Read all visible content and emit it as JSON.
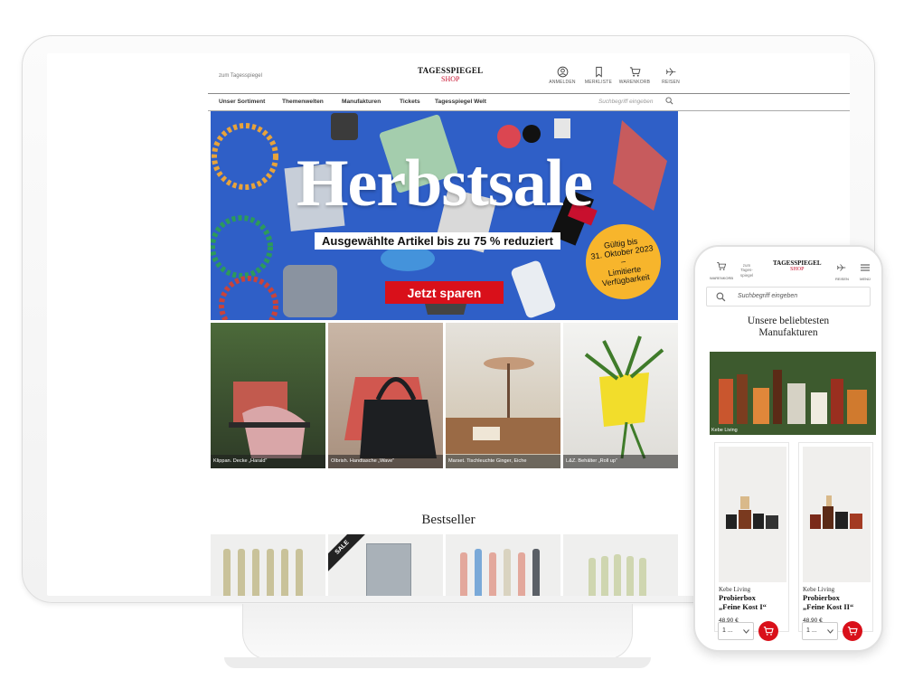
{
  "header": {
    "to_paper": "zum Tagesspiegel",
    "logo_line1": "TAGESSPIEGEL",
    "logo_line2": "SHOP",
    "icons": [
      {
        "icon": "user-icon",
        "label": "ANMELDEN"
      },
      {
        "icon": "bookmark-icon",
        "label": "MERKLISTE"
      },
      {
        "icon": "cart-icon",
        "label": "WARENKORB"
      },
      {
        "icon": "plane-icon",
        "label": "REISEN"
      }
    ]
  },
  "nav": {
    "items": [
      "Unser Sortiment",
      "Themenwelten",
      "Manufakturen",
      "Tickets",
      "Tagesspiegel Welt"
    ],
    "search_placeholder": "Suchbegriff eingeben"
  },
  "hero": {
    "title": "Herbstsale",
    "subtitle": "Ausgewählte Artikel bis zu 75 % reduziert",
    "button": "Jetzt sparen",
    "badge_lines": [
      "Gültig bis",
      "31. Oktober 2023",
      "–",
      "Limitierte",
      "Verfügbarkeit"
    ],
    "background_color": "#2f5fc7",
    "button_color": "#d9101a",
    "badge_color": "#f7b52c"
  },
  "tiles": [
    {
      "caption": "Klippan. Decke „Harald“"
    },
    {
      "caption": "Olbrish. Handtasche „Wave“"
    },
    {
      "caption": "Marset. Tischleuchte Ginger, Eiche"
    },
    {
      "caption": "L&Z. Behälter „Roll up“"
    }
  ],
  "bestseller": {
    "title": "Bestseller",
    "sale_label": "SALE"
  },
  "mobile": {
    "head_cart_label": "WARENKORB",
    "head_paper": "zum Tages-spiegel",
    "head_logo": "TAGESSPIEGEL",
    "head_logo2": "SHOP",
    "head_reisen": "REISEN",
    "head_menu": "MENÜ",
    "search_placeholder": "Suchbegriff eingeben",
    "section_title_1": "Unsere beliebtesten",
    "section_title_2": "Manufakturen",
    "banner_caption": "Kebe Living",
    "cards": [
      {
        "brand": "Kebe Living",
        "name_1": "Probierbox",
        "name_2": "„Feine Kost I“",
        "price": "48,90 €",
        "qty": "1 ..."
      },
      {
        "brand": "Kebe Living",
        "name_1": "Probierbox",
        "name_2": "„Feine Kost II“",
        "price": "48,90 €",
        "qty": "1 ..."
      }
    ]
  }
}
